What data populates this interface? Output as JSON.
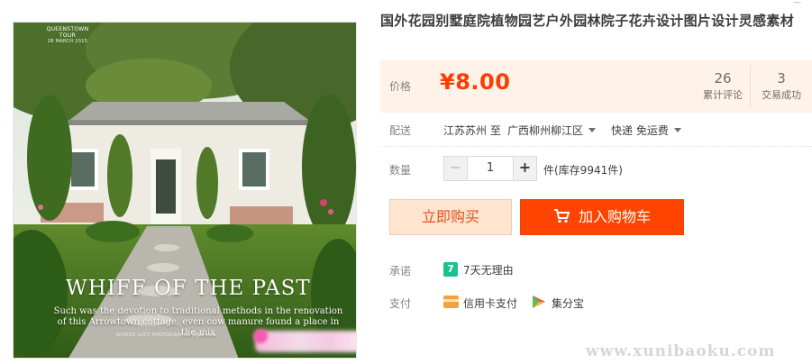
{
  "product": {
    "title": "国外花园别墅庭院植物园艺户外园林院子花卉设计图片设计灵感素材",
    "image": {
      "magazine_tag": "QUEENSTOWN TOUR",
      "magazine_date": "28 MARCH 2015",
      "headline": "WHIFF OF THE PAST",
      "caption": "Such was the devotion to traditional methods in the renovation of this Arrowtown cottage, even cow manure found a place in the mix",
      "credits": "WORDS LUCY PHOTOGRAPHS JANE USS"
    }
  },
  "header": {
    "corner_text": "—"
  },
  "price": {
    "label": "价格",
    "value": "¥8.00",
    "currency_color": "#ff3c00",
    "reviews_count": "26",
    "reviews_label": "累计评论",
    "transactions_count": "3",
    "transactions_label": "交易成功"
  },
  "delivery": {
    "label": "配送",
    "origin": "江苏苏州 至",
    "destination": "广西柳州柳江区",
    "shipping": "快递 免运费"
  },
  "quantity": {
    "label": "数量",
    "minus": "−",
    "value": "1",
    "plus": "+",
    "stock": "件(库存9941件)"
  },
  "actions": {
    "buy_now": "立即购买",
    "add_to_cart": "加入购物车",
    "buy_now_color": "#ffe4d0",
    "add_to_cart_color": "#ff4400"
  },
  "promise": {
    "label": "承诺",
    "icon_text": "7",
    "icon": "seven-day-return-icon",
    "text": "7天无理由"
  },
  "payment": {
    "label": "支付",
    "methods": [
      {
        "icon": "credit-card-icon",
        "text": "信用卡支付"
      },
      {
        "icon": "jifenbao-icon",
        "text": "集分宝"
      }
    ]
  },
  "watermark": {
    "text": "www.xunibaoku.com"
  }
}
